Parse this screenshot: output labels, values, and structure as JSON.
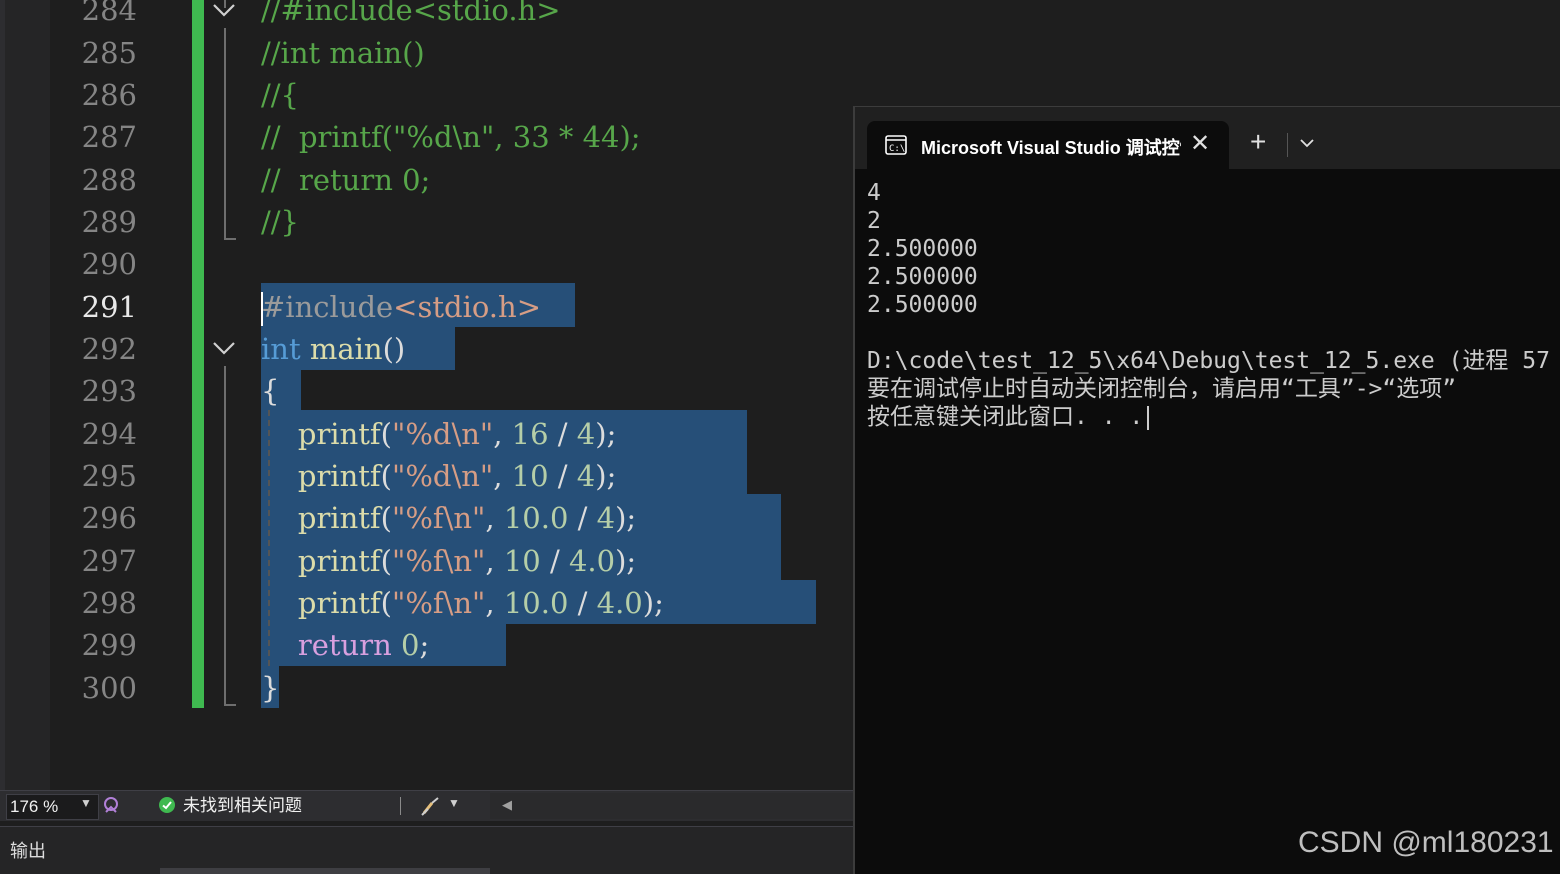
{
  "editor": {
    "line_numbers": [
      "284",
      "285",
      "286",
      "287",
      "288",
      "289",
      "290",
      "291",
      "292",
      "293",
      "294",
      "295",
      "296",
      "297",
      "298",
      "299",
      "300"
    ],
    "current_line": "291",
    "code": {
      "l284": "//#include<stdio.h>",
      "l285": "//int main()",
      "l286": "//{",
      "l287": "//  printf(\"%d\\n\", 33 * 44);",
      "l288": "//  return 0;",
      "l289": "//}",
      "l291_hash": "#include",
      "l291_header": "<stdio.h>",
      "l292_kw": "int",
      "l292_fn": "main",
      "l292_paren": "()",
      "l293": "{",
      "l294": {
        "fn": "printf",
        "open": "(",
        "str": "\"%d\\n\"",
        "comma": ", ",
        "n1": "16",
        "op": " / ",
        "n2": "4",
        "close": ");"
      },
      "l295": {
        "fn": "printf",
        "open": "(",
        "str": "\"%d\\n\"",
        "comma": ", ",
        "n1": "10",
        "op": " / ",
        "n2": "4",
        "close": ");"
      },
      "l296": {
        "fn": "printf",
        "open": "(",
        "str": "\"%f\\n\"",
        "comma": ", ",
        "n1": "10.0",
        "op": " / ",
        "n2": "4",
        "close": ");"
      },
      "l297": {
        "fn": "printf",
        "open": "(",
        "str": "\"%f\\n\"",
        "comma": ", ",
        "n1": "10",
        "op": " / ",
        "n2": "4.0",
        "close": ");"
      },
      "l298": {
        "fn": "printf",
        "open": "(",
        "str": "\"%f\\n\"",
        "comma": ", ",
        "n1": "10.0",
        "op": " / ",
        "n2": "4.0",
        "close": ");"
      },
      "l299_kw": "return",
      "l299_num": "0",
      "l299_end": ";",
      "l300": "}"
    }
  },
  "statusbar": {
    "zoom": "176 %",
    "issues_text": "未找到相关问题"
  },
  "output_panel": {
    "title": "输出"
  },
  "terminal": {
    "tab_title": "Microsoft Visual Studio 调试控制台",
    "new_tab_label": "+",
    "lines": [
      "4",
      "2",
      "2.500000",
      "2.500000",
      "2.500000",
      "",
      "D:\\code\\test_12_5\\x64\\Debug\\test_12_5.exe (进程 57",
      "要在调试停止时自动关闭控制台，请启用“工具”->“选项”",
      "按任意键关闭此窗口. . ."
    ]
  },
  "watermark": "CSDN @ml180231",
  "colors": {
    "editor_bg": "#1e1e1e",
    "selection": "#264f78",
    "change_bar": "#3fb950",
    "comment": "#57a64a",
    "keyword": "#569cd6",
    "control_keyword": "#d8a0df",
    "string": "#d69d85",
    "number": "#b5cea8",
    "function": "#dcdcaa",
    "terminal_bg": "#0c0c0c"
  }
}
